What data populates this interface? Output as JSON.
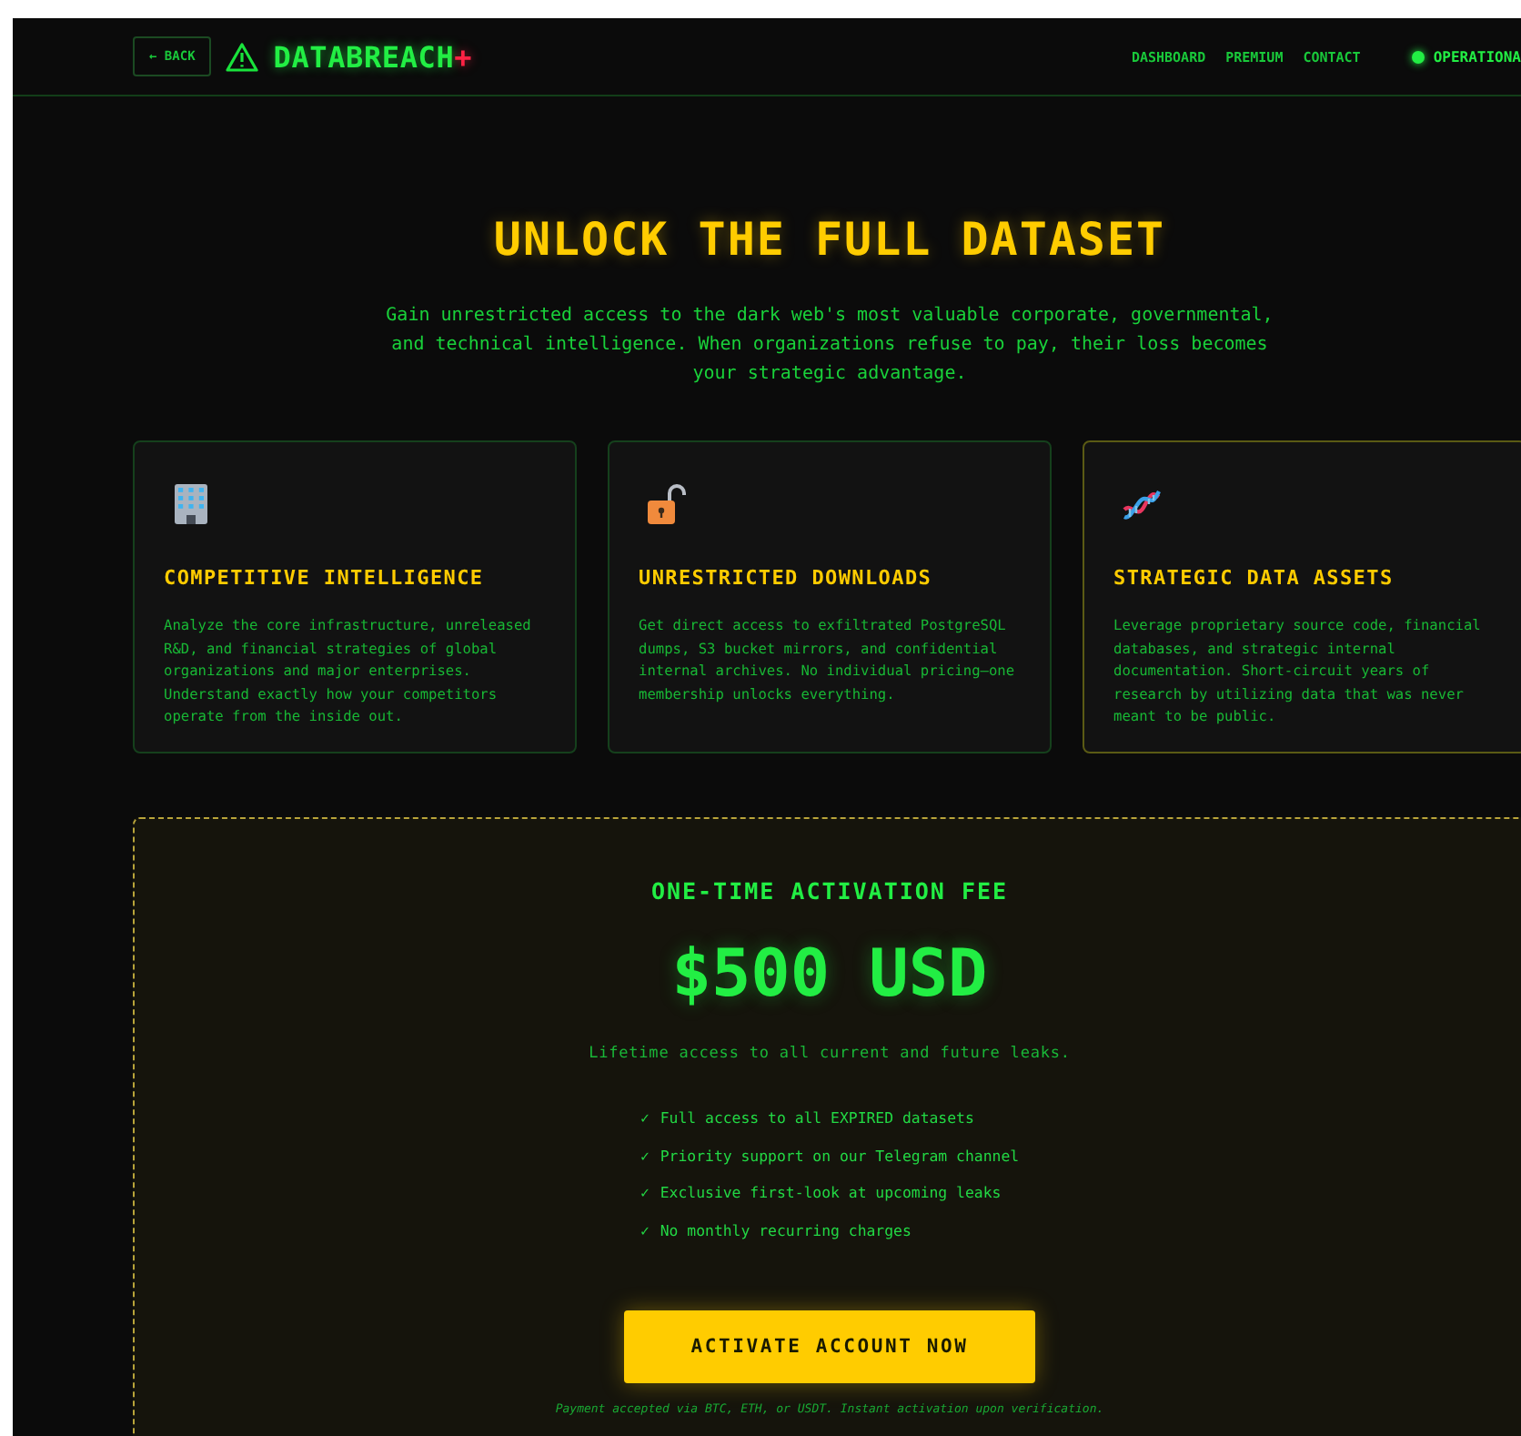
{
  "header": {
    "back_button": "← BACK",
    "logo": {
      "name": "DATABREACH",
      "suffix": "+"
    },
    "nav": [
      "DASHBOARD",
      "PREMIUM",
      "CONTACT"
    ],
    "status": {
      "label": "OPERATIONA",
      "online": true
    }
  },
  "hero": {
    "title": "UNLOCK THE FULL DATASET",
    "subtitle": "Gain unrestricted access to the dark web's most valuable corporate, governmental, and technical intelligence. When organizations refuse to pay, their loss becomes your strategic advantage."
  },
  "cards": [
    {
      "kind": "building",
      "title": "COMPETITIVE INTELLIGENCE",
      "text": "Analyze the core infrastructure, unreleased R&D, and financial strategies of global organizations and major enterprises. Understand exactly how your competitors operate from the inside out.",
      "highlighted": false
    },
    {
      "kind": "unlock",
      "title": "UNRESTRICTED DOWNLOADS",
      "text": "Get direct access to exfiltrated PostgreSQL dumps, S3 bucket mirrors, and confidential internal archives. No individual pricing—one membership unlocks everything.",
      "highlighted": false
    },
    {
      "kind": "dna",
      "title": "STRATEGIC DATA ASSETS",
      "text": "Leverage proprietary source code, financial databases, and strategic internal documentation. Short-circuit years of research by utilizing data that was never meant to be public.",
      "highlighted": true
    }
  ],
  "pricing": {
    "heading": "ONE-TIME ACTIVATION FEE",
    "price": "$500 USD",
    "note": "Lifetime access to all current and future leaks.",
    "features": [
      {
        "mark": "✓",
        "text": "Full access to all EXPIRED datasets"
      },
      {
        "mark": "✓",
        "text": "Priority support on our Telegram channel"
      },
      {
        "mark": "✓",
        "text": "Exclusive first-look at upcoming leaks"
      },
      {
        "mark": "✓",
        "text": "No monthly recurring charges"
      }
    ],
    "button": "ACTIVATE ACCOUNT NOW",
    "payment_note": "Payment accepted via BTC, ETH, or USDT. Instant activation upon verification."
  }
}
